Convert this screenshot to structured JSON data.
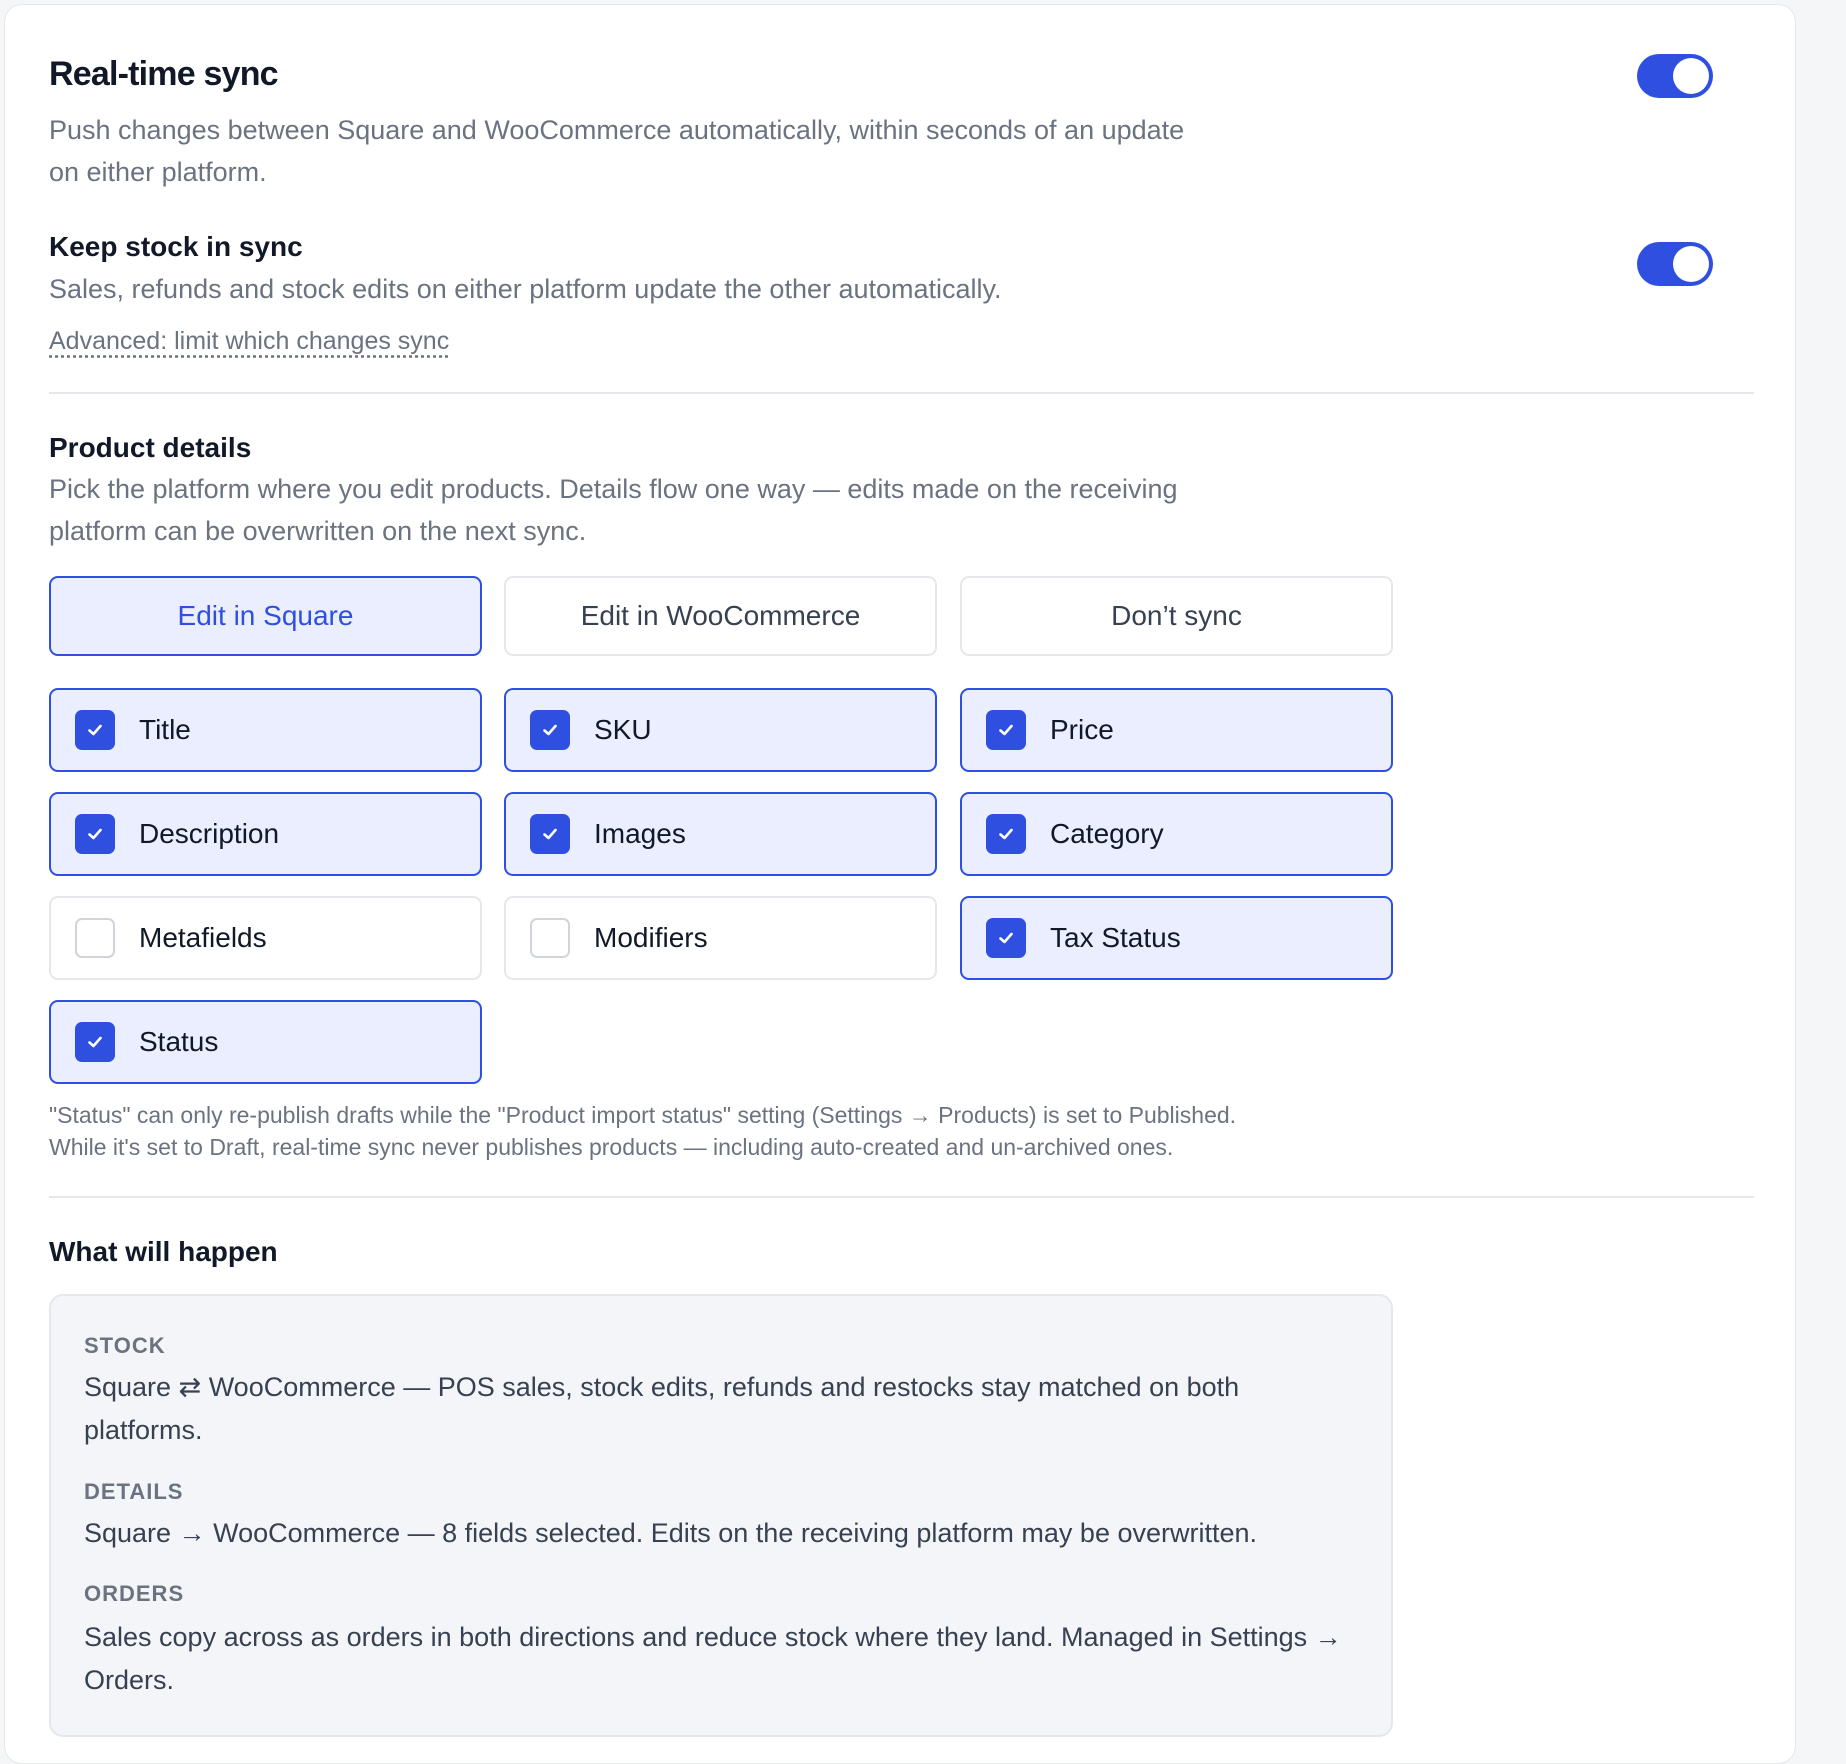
{
  "realtime": {
    "title": "Real-time sync",
    "description": "Push changes between Square and WooCommerce automatically, within seconds of an update on either platform.",
    "enabled": true
  },
  "stock": {
    "title": "Keep stock in sync",
    "description": "Sales, refunds and stock edits on either platform update the other automatically.",
    "advanced_link": "Advanced: limit which changes sync",
    "enabled": true
  },
  "product_details": {
    "title": "Product details",
    "description": "Pick the platform where you edit products. Details flow one way — edits made on the receiving platform can be overwritten on the next sync.",
    "options": [
      "Edit in Square",
      "Edit in WooCommerce",
      "Don’t sync"
    ],
    "selected_option": "Edit in Square",
    "fields": [
      {
        "label": "Title",
        "checked": true
      },
      {
        "label": "SKU",
        "checked": true
      },
      {
        "label": "Price",
        "checked": true
      },
      {
        "label": "Description",
        "checked": true
      },
      {
        "label": "Images",
        "checked": true
      },
      {
        "label": "Category",
        "checked": true
      },
      {
        "label": "Metafields",
        "checked": false
      },
      {
        "label": "Modifiers",
        "checked": false
      },
      {
        "label": "Tax Status",
        "checked": true
      },
      {
        "label": "Status",
        "checked": true
      }
    ],
    "note_line1": "\"Status\" can only re-publish drafts while the \"Product import status\" setting (Settings → Products) is set to Published.",
    "note_line2": "While it's set to Draft, real-time sync never publishes products — including auto-created and un-archived ones."
  },
  "summary": {
    "title": "What will happen",
    "stock_heading": "STOCK",
    "stock_text": "Square ⇄ WooCommerce — POS sales, stock edits, refunds and restocks stay matched on both platforms.",
    "details_heading": "DETAILS",
    "details_text": "Square → WooCommerce — 8 fields selected. Edits on the receiving platform may be overwritten.",
    "orders_heading": "ORDERS",
    "orders_text": "Sales copy across as orders in both directions and reduce stock where they land. Managed in Settings → Orders."
  },
  "colors": {
    "accent": "#2f4fe0",
    "accent_bg": "#eaeeff",
    "muted_text": "#6b7280",
    "border": "#e5e7eb"
  },
  "icons": {
    "check": "check-icon"
  }
}
